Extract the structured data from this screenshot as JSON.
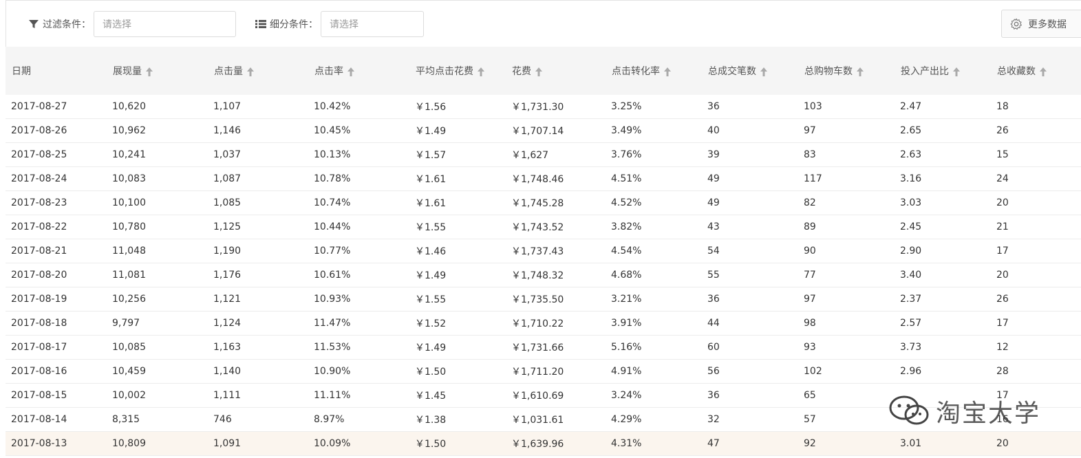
{
  "filters": {
    "filter_label": "过滤条件：",
    "filter_placeholder": "请选择",
    "segment_label": "细分条件：",
    "segment_placeholder": "请选择"
  },
  "more_button": {
    "label": "更多数据"
  },
  "table": {
    "columns": [
      "日期",
      "展现量",
      "点击量",
      "点击率",
      "平均点击花费",
      "花费",
      "点击转化率",
      "总成交笔数",
      "总购物车数",
      "投入产出比",
      "总收藏数"
    ],
    "rows": [
      [
        "2017-08-27",
        "10,620",
        "1,107",
        "10.42%",
        "￥1.56",
        "￥1,731.30",
        "3.25%",
        "36",
        "103",
        "2.47",
        "18"
      ],
      [
        "2017-08-26",
        "10,962",
        "1,146",
        "10.45%",
        "￥1.49",
        "￥1,707.14",
        "3.49%",
        "40",
        "97",
        "2.65",
        "26"
      ],
      [
        "2017-08-25",
        "10,241",
        "1,037",
        "10.13%",
        "￥1.57",
        "￥1,627",
        "3.76%",
        "39",
        "83",
        "2.63",
        "15"
      ],
      [
        "2017-08-24",
        "10,083",
        "1,087",
        "10.78%",
        "￥1.61",
        "￥1,748.46",
        "4.51%",
        "49",
        "117",
        "3.16",
        "24"
      ],
      [
        "2017-08-23",
        "10,100",
        "1,085",
        "10.74%",
        "￥1.61",
        "￥1,745.28",
        "4.52%",
        "49",
        "82",
        "3.03",
        "20"
      ],
      [
        "2017-08-22",
        "10,780",
        "1,125",
        "10.44%",
        "￥1.55",
        "￥1,743.52",
        "3.82%",
        "43",
        "89",
        "2.45",
        "21"
      ],
      [
        "2017-08-21",
        "11,048",
        "1,190",
        "10.77%",
        "￥1.46",
        "￥1,737.43",
        "4.54%",
        "54",
        "90",
        "2.90",
        "17"
      ],
      [
        "2017-08-20",
        "11,081",
        "1,176",
        "10.61%",
        "￥1.49",
        "￥1,748.32",
        "4.68%",
        "55",
        "77",
        "3.40",
        "20"
      ],
      [
        "2017-08-19",
        "10,256",
        "1,121",
        "10.93%",
        "￥1.55",
        "￥1,735.50",
        "3.21%",
        "36",
        "97",
        "2.37",
        "26"
      ],
      [
        "2017-08-18",
        "9,797",
        "1,124",
        "11.47%",
        "￥1.52",
        "￥1,710.22",
        "3.91%",
        "44",
        "98",
        "2.57",
        "17"
      ],
      [
        "2017-08-17",
        "10,085",
        "1,163",
        "11.53%",
        "￥1.49",
        "￥1,731.66",
        "5.16%",
        "60",
        "93",
        "3.73",
        "12"
      ],
      [
        "2017-08-16",
        "10,459",
        "1,140",
        "10.90%",
        "￥1.50",
        "￥1,711.20",
        "4.91%",
        "56",
        "102",
        "2.96",
        "28"
      ],
      [
        "2017-08-15",
        "10,002",
        "1,111",
        "11.11%",
        "￥1.45",
        "￥1,610.69",
        "3.24%",
        "36",
        "65",
        "",
        "17"
      ],
      [
        "2017-08-14",
        "8,315",
        "746",
        "8.97%",
        "￥1.38",
        "￥1,031.61",
        "4.29%",
        "32",
        "57",
        "",
        "16"
      ],
      [
        "2017-08-13",
        "10,809",
        "1,091",
        "10.09%",
        "￥1.50",
        "￥1,639.96",
        "4.31%",
        "47",
        "92",
        "3.01",
        "20"
      ]
    ],
    "highlight_row": 14
  },
  "watermark": {
    "text": "淘宝大学",
    "icon": "wechat-icon"
  },
  "colors": {
    "header_bg": "#f5f5f5",
    "highlight_row_bg": "#fbf5ee",
    "border": "#ececec"
  }
}
